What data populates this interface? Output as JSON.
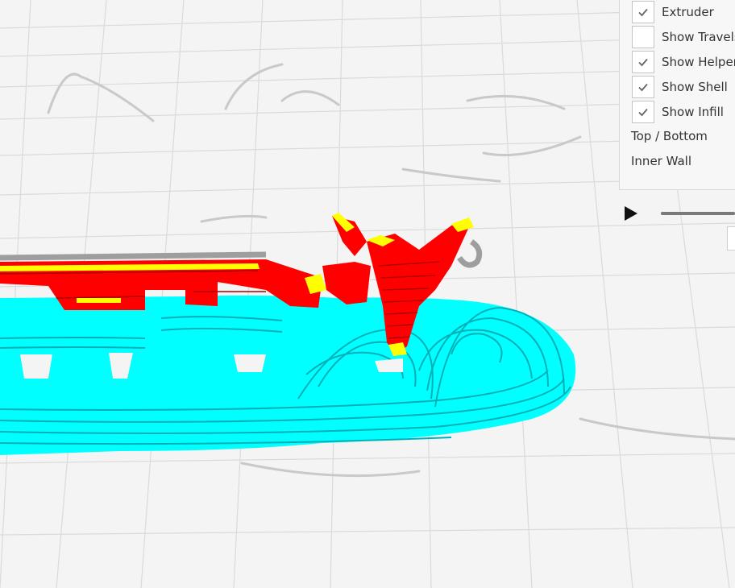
{
  "layer_view_panel": {
    "checkboxes": [
      {
        "label": "Extruder",
        "checked": true
      },
      {
        "label": "Show Travels",
        "checked": false
      },
      {
        "label": "Show Helpers",
        "checked": true
      },
      {
        "label": "Show Shell",
        "checked": true
      },
      {
        "label": "Show Infill",
        "checked": true
      }
    ],
    "legend": [
      "Top / Bottom",
      "Inner Wall"
    ]
  },
  "simulation": {
    "play_icon": "play-icon",
    "progress": 1.0
  },
  "colors": {
    "shell": "#ff0000",
    "top_bottom": "#ffff00",
    "inner_wall": "#00ffff",
    "helpers": "#9e9e9e",
    "grid": "#dcdcdc",
    "background": "#f4f4f4"
  },
  "icons": {
    "check": "checkmark-icon",
    "play": "play-icon"
  }
}
